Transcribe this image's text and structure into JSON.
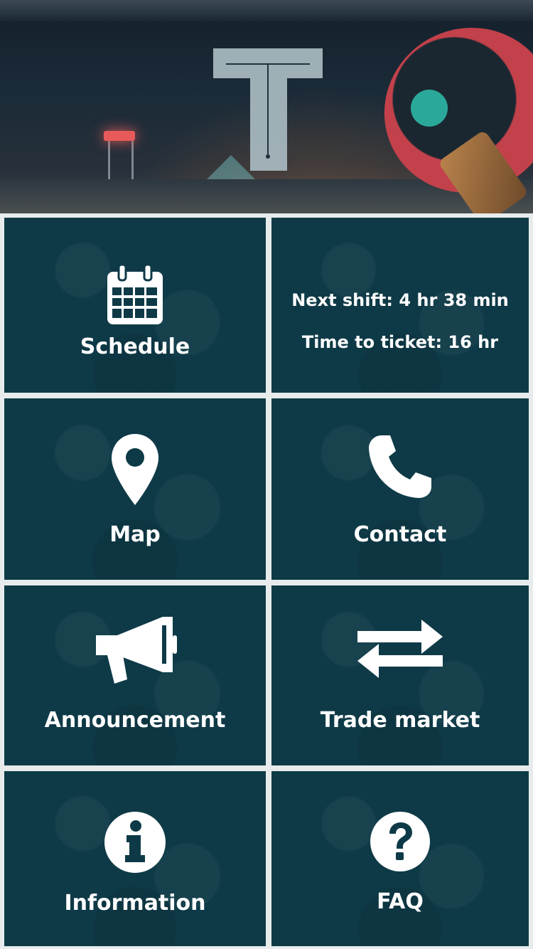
{
  "header": {
    "logo_icon": "festival-t-logo-icon"
  },
  "tiles": {
    "schedule": {
      "label": "Schedule",
      "icon": "calendar-icon"
    },
    "status": {
      "next_shift": "Next shift: 4 hr 38 min",
      "time_to_ticket": "Time to ticket: 16 hr"
    },
    "map": {
      "label": "Map",
      "icon": "map-pin-icon"
    },
    "contact": {
      "label": "Contact",
      "icon": "phone-icon"
    },
    "announcement": {
      "label": "Announcement",
      "icon": "megaphone-icon"
    },
    "trade_market": {
      "label": "Trade market",
      "icon": "swap-arrows-icon"
    },
    "information": {
      "label": "Information",
      "icon": "info-icon"
    },
    "faq": {
      "label": "FAQ",
      "icon": "question-icon"
    }
  },
  "colors": {
    "tile_background": "#0e3a47",
    "gutter": "#e8ebec",
    "text": "#ffffff",
    "logo": "#a5b6bd"
  }
}
